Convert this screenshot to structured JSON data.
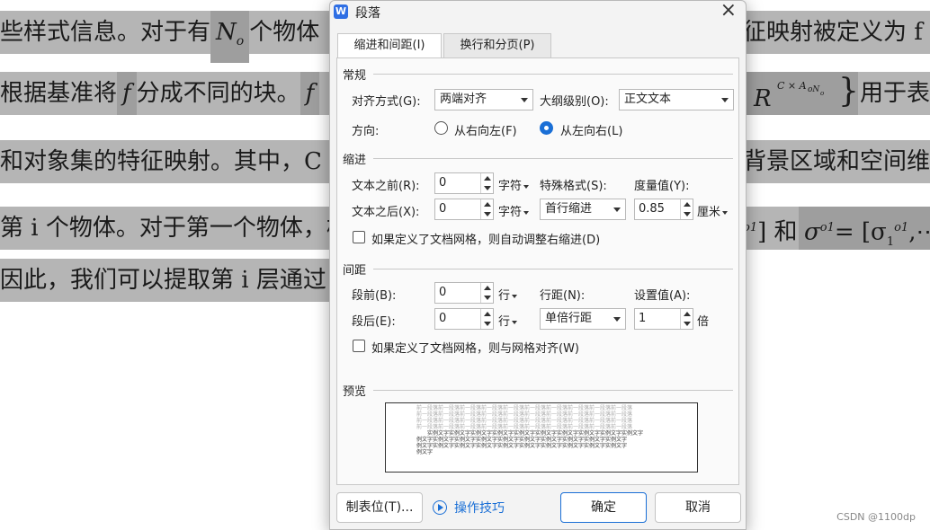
{
  "document": {
    "line1_left": "些样式信息。对于有",
    "line1_math": "N",
    "line1_math_sub": "o",
    "line1_mid": "个物体",
    "line1_right": "征映射被定义为 f",
    "line2_left": "根据基准将",
    "line2_math": "f",
    "line2_mid": "分成不同的块。",
    "line2_math2": "f",
    "line2_right_math": "R",
    "line2_right_sup": "C × A",
    "line2_right_sub": "oN",
    "line2_right_sub2": "o",
    "line2_brace": "}",
    "line2_right": "用于表",
    "line3_left": "和对象集的特征映射。其中，C",
    "line3_right": "背景区域和空间维",
    "line4_left": "第 i 个物体。对于第一个物体，枯",
    "line4_right_a": "o1",
    "line4_right_b": "] 和",
    "line4_right_sigma": "σ",
    "line4_right_sup": "o1",
    "line4_right_eq": "= [σ",
    "line4_right_sub": "1",
    "line4_right_sup2": "o1",
    "line4_right_tail": ",⋯",
    "line5_left": "因此，我们可以提取第 i 层通过"
  },
  "dialog": {
    "title": "段落",
    "app_icon": "W",
    "close_icon": "×",
    "tabs": [
      {
        "label": "缩进和间距(I)"
      },
      {
        "label": "换行和分页(P)"
      }
    ],
    "general": {
      "heading": "常规",
      "alignment_label": "对齐方式(G):",
      "alignment_value": "两端对齐",
      "outline_label": "大纲级别(O):",
      "outline_value": "正文文本",
      "direction_label": "方向:",
      "rtl_label": "从右向左(F)",
      "ltr_label": "从左向右(L)"
    },
    "indent": {
      "heading": "缩进",
      "before_label": "文本之前(R):",
      "before_value": "0",
      "before_unit": "字符",
      "after_label": "文本之后(X):",
      "after_value": "0",
      "after_unit": "字符",
      "special_label": "特殊格式(S):",
      "special_value": "首行缩进",
      "measure_label": "度量值(Y):",
      "measure_value": "0.85",
      "measure_unit": "厘米",
      "auto_adjust_label": "如果定义了文档网格，则自动调整右缩进(D)"
    },
    "spacing": {
      "heading": "间距",
      "before_label": "段前(B):",
      "before_value": "0",
      "before_unit": "行",
      "after_label": "段后(E):",
      "after_value": "0",
      "after_unit": "行",
      "line_label": "行距(N):",
      "line_value": "单倍行距",
      "setting_label": "设置值(A):",
      "setting_value": "1",
      "setting_unit": "倍",
      "grid_label": "如果定义了文档网格，则与网格对齐(W)"
    },
    "preview": {
      "heading": "预览",
      "prev_line": "前一段落前一段落前一段落前一段落前一段落前一段落前一段落前一段落前一段落前一段落",
      "sample_line": "实例文字实例文字实例文字实例文字实例文字实例文字实例文字实例文字实例文字实例文字",
      "sample_line2": "例文字实例文字实例文字实例文字实例文字实例文字实例文字实例文字实例文字实例文字",
      "sample_short": "例文字"
    },
    "buttons": {
      "tabs_label": "制表位(T)...",
      "tips_label": "操作技巧",
      "ok_label": "确定",
      "cancel_label": "取消"
    }
  },
  "watermark": "CSDN @1100dp",
  "colors": {
    "accent": "#1a6fd6",
    "selection": "#b5b5b5",
    "dialog_bg": "#f3f3f3"
  }
}
